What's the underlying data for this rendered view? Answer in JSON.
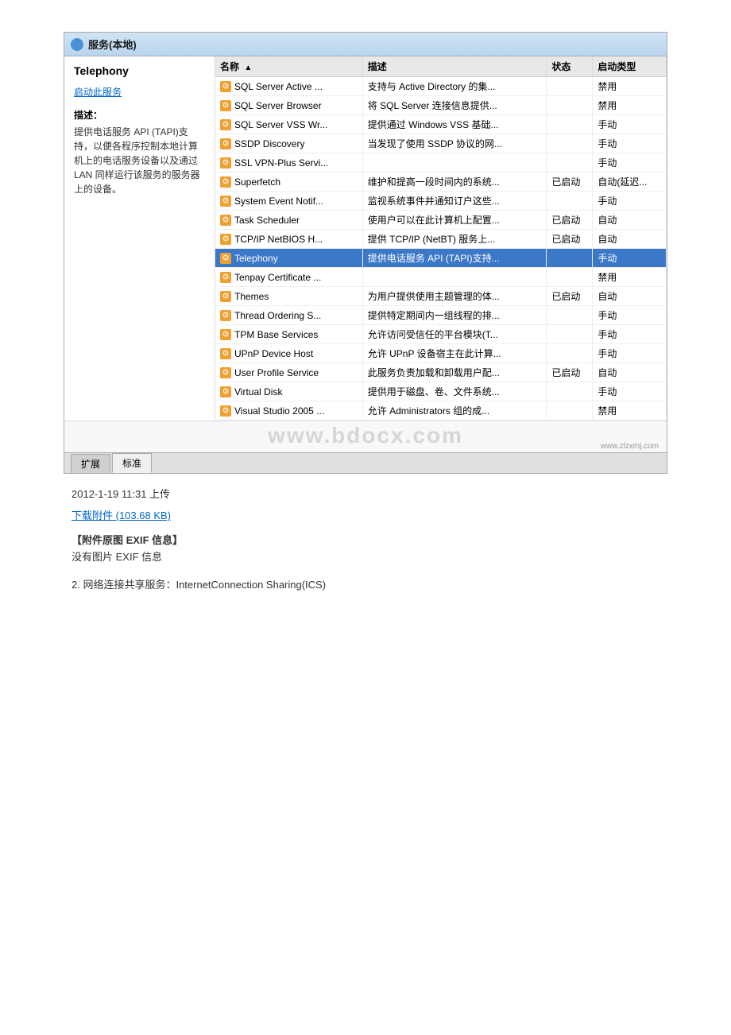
{
  "window": {
    "title": "服务(本地)",
    "left": {
      "service_title": "Telephony",
      "link_text": "启动此服务",
      "desc_label": "描述：",
      "desc_text": "提供电话服务 API (TAPI)支持，以便各程序控制本地计算机上的电话服务设备以及通过 LAN 同样运行该服务的服务器上的设备。"
    },
    "table": {
      "headers": [
        "名称",
        "描述",
        "状态",
        "启动类型"
      ],
      "rows": [
        {
          "name": "SQL Server Active ...",
          "desc": "支持与 Active Directory 的集...",
          "status": "",
          "starttype": "禁用",
          "selected": false
        },
        {
          "name": "SQL Server Browser",
          "desc": "将 SQL Server 连接信息提供...",
          "status": "",
          "starttype": "禁用",
          "selected": false
        },
        {
          "name": "SQL Server VSS Wr...",
          "desc": "提供通过 Windows VSS 基础...",
          "status": "",
          "starttype": "手动",
          "selected": false
        },
        {
          "name": "SSDP Discovery",
          "desc": "当发现了使用 SSDP 协议的网...",
          "status": "",
          "starttype": "手动",
          "selected": false
        },
        {
          "name": "SSL VPN-Plus Servi...",
          "desc": "",
          "status": "",
          "starttype": "手动",
          "selected": false
        },
        {
          "name": "Superfetch",
          "desc": "维护和提高一段时间内的系统...",
          "status": "已启动",
          "starttype": "自动(延迟...",
          "selected": false
        },
        {
          "name": "System Event Notif...",
          "desc": "监视系统事件并通知订户这些...",
          "status": "",
          "starttype": "手动",
          "selected": false
        },
        {
          "name": "Task Scheduler",
          "desc": "使用户可以在此计算机上配置...",
          "status": "已启动",
          "starttype": "自动",
          "selected": false
        },
        {
          "name": "TCP/IP NetBIOS H...",
          "desc": "提供 TCP/IP (NetBT) 服务上...",
          "status": "已启动",
          "starttype": "自动",
          "selected": false
        },
        {
          "name": "Telephony",
          "desc": "提供电话服务 API (TAPI)支持...",
          "status": "",
          "starttype": "手动",
          "selected": true
        },
        {
          "name": "Tenpay Certificate ...",
          "desc": "",
          "status": "",
          "starttype": "禁用",
          "selected": false
        },
        {
          "name": "Themes",
          "desc": "为用户提供使用主题管理的体...",
          "status": "已启动",
          "starttype": "自动",
          "selected": false
        },
        {
          "name": "Thread Ordering S...",
          "desc": "提供特定期间内一组线程的排...",
          "status": "",
          "starttype": "手动",
          "selected": false
        },
        {
          "name": "TPM Base Services",
          "desc": "允许访问受信任的平台模块(T...",
          "status": "",
          "starttype": "手动",
          "selected": false
        },
        {
          "name": "UPnP Device Host",
          "desc": "允许 UPnP 设备宿主在此计算...",
          "status": "",
          "starttype": "手动",
          "selected": false
        },
        {
          "name": "User Profile Service",
          "desc": "此服务负责加载和卸载用户配...",
          "status": "已启动",
          "starttype": "自动",
          "selected": false
        },
        {
          "name": "Virtual Disk",
          "desc": "提供用于磁盘、卷、文件系统...",
          "status": "",
          "starttype": "手动",
          "selected": false
        },
        {
          "name": "Visual Studio 2005 ...",
          "desc": "允许 Administrators 组的成...",
          "status": "",
          "starttype": "禁用",
          "selected": false
        }
      ]
    },
    "tabs": [
      "扩展",
      "标准"
    ]
  },
  "watermark": {
    "text": "www.bdocx.com",
    "small": "www.zlzxmj.com"
  },
  "below": {
    "upload_date": "2012-1-19 11:31 上传",
    "download_text": "下载附件 (103.68 KB)",
    "exif_title": "【附件原图 EXIF 信息】",
    "exif_none": "没有图片 EXIF 信息",
    "section2": "2. 网络连接共享服务：InternetConnection Sharing(ICS)"
  }
}
